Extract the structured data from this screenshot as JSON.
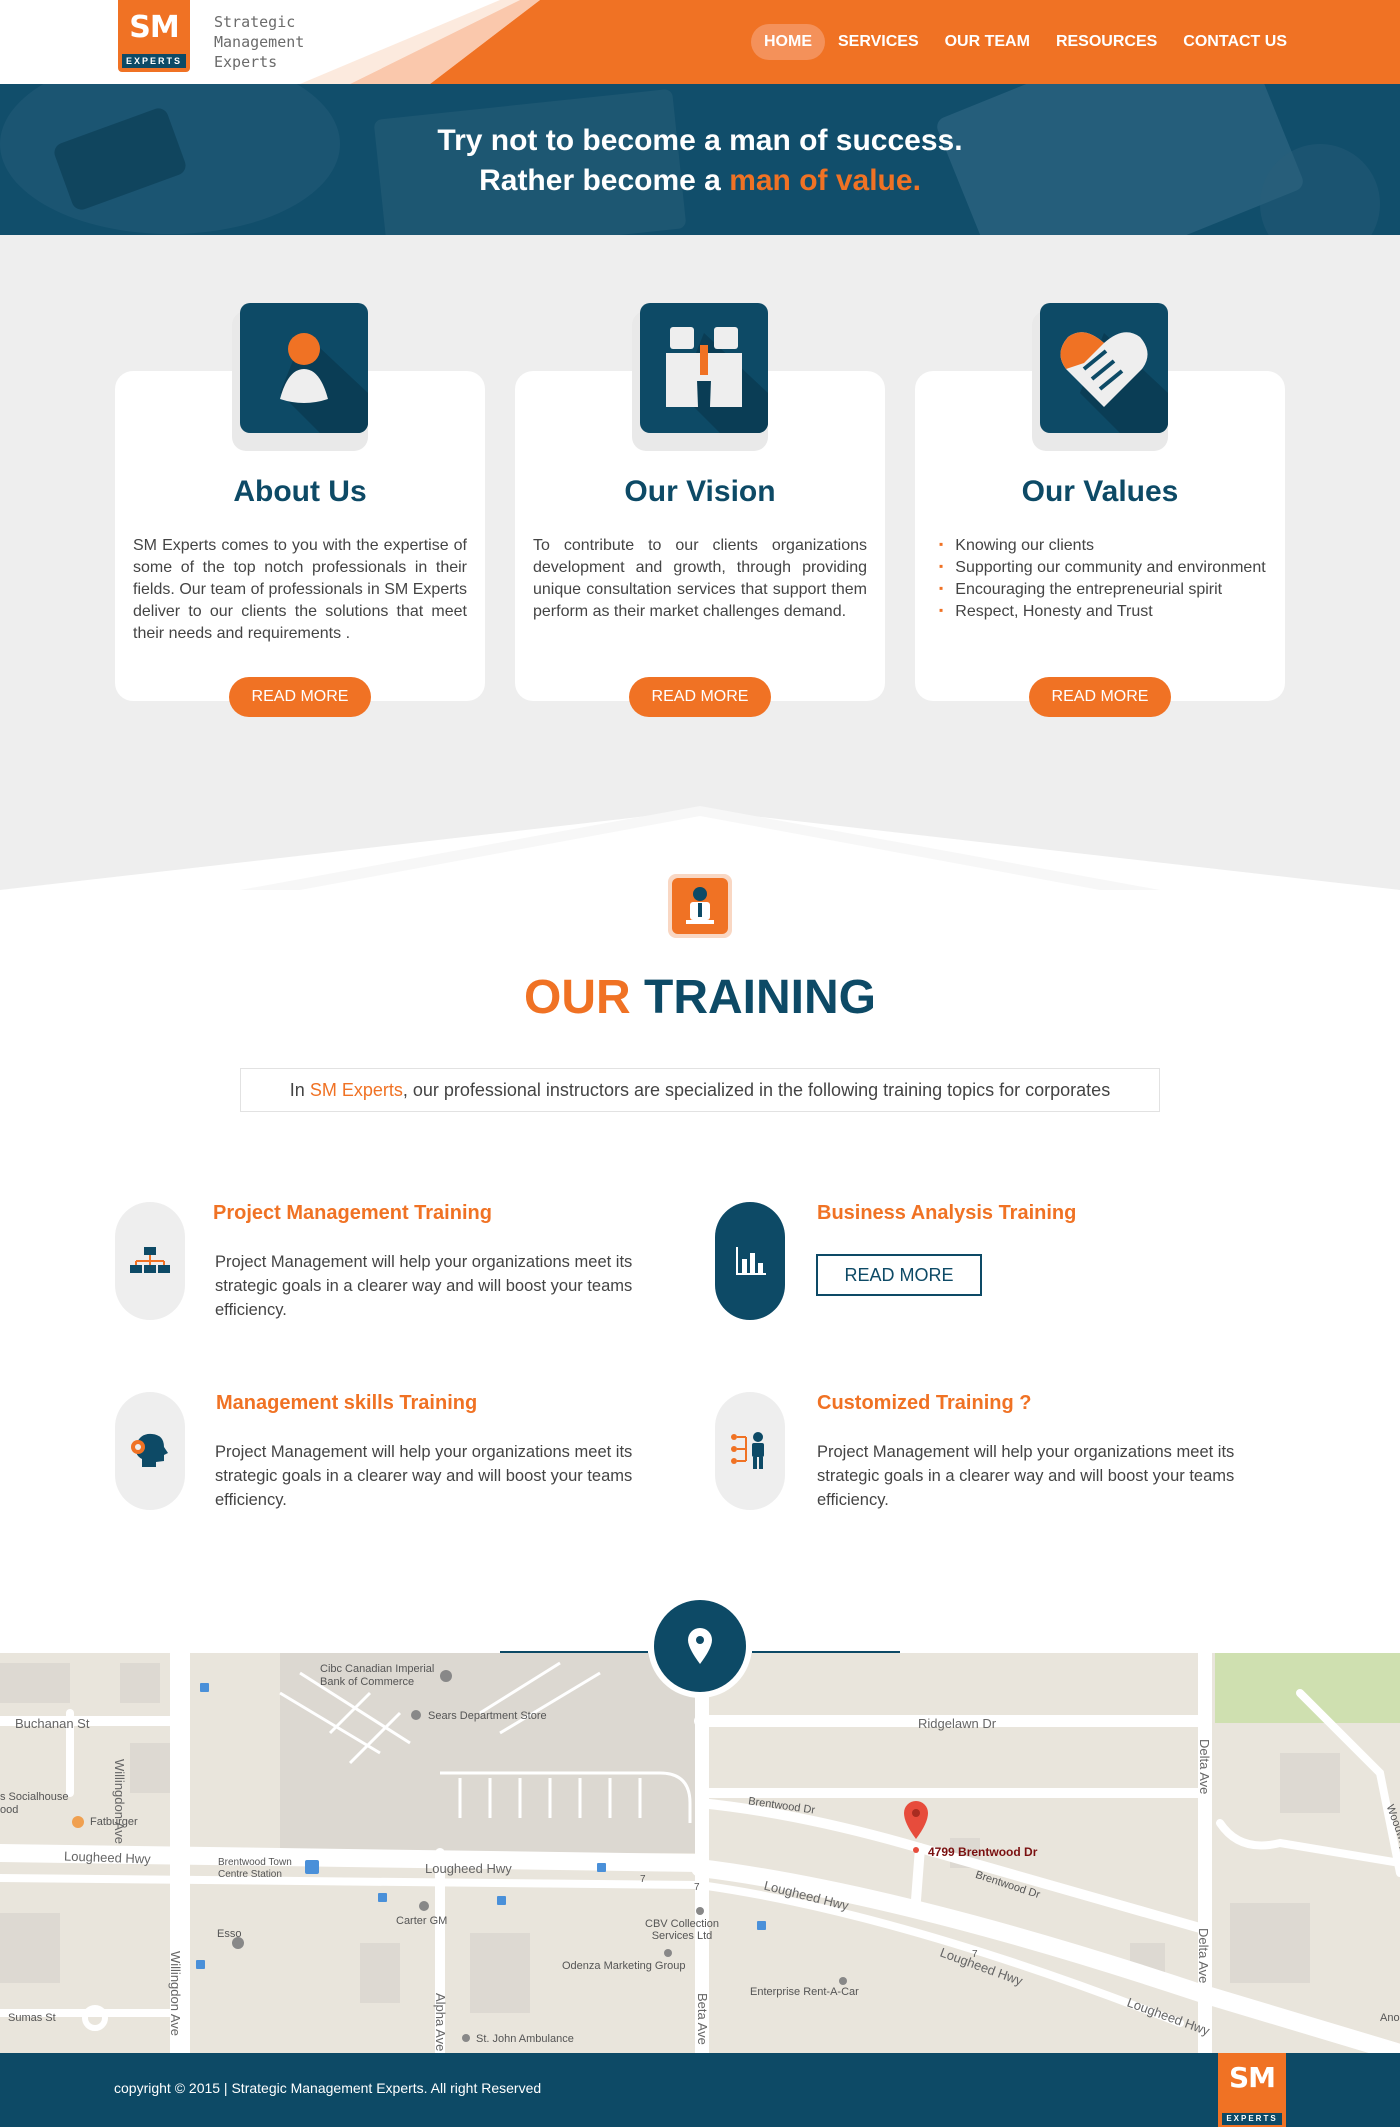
{
  "header": {
    "logo_mark": "SM",
    "logo_sub": "EXPERTS",
    "brand_lines": [
      "Strategic",
      "Management",
      "Experts"
    ],
    "nav": [
      "HOME",
      "SERVICES",
      "OUR TEAM",
      "RESOURCES",
      "CONTACT US"
    ],
    "active_nav": "HOME"
  },
  "hero": {
    "line1": "Try not to become a man of success.",
    "line2_prefix": "Rather become a ",
    "line2_accent": "man of value."
  },
  "features": [
    {
      "title": "About Us",
      "icon": "person-icon",
      "text": "SM Experts comes to you with the expertise of some of the top notch professionals in their fields. Our team of professionals in SM Experts deliver to our clients the solutions that meet their needs and requirements .",
      "button": "READ MORE"
    },
    {
      "title": "Our Vision",
      "icon": "binoculars-icon",
      "text": "To contribute to our clients organizations development and growth, through providing unique consultation services that support them perform as their market challenges demand.",
      "button": "READ MORE"
    },
    {
      "title": "Our Values",
      "icon": "handshake-icon",
      "list": [
        "Knowing our clients",
        "Supporting our community and environment",
        "Encouraging the entrepreneurial spirit",
        "Respect, Honesty and Trust"
      ],
      "button": "READ MORE"
    }
  ],
  "training": {
    "title_accent": "OUR",
    "title_rest": "TRAINING",
    "sub_prefix": "In ",
    "sub_accent": "SM Experts",
    "sub_rest": ", our professional instructors are specialized in the following training topics for corporates",
    "items": [
      {
        "title": "Project Management Training",
        "icon": "org-chart-icon",
        "desc": "Project Management will help your organizations meet its strategic goals in a clearer way and will boost your teams efficiency."
      },
      {
        "title": "Business Analysis Training",
        "icon": "bar-chart-icon",
        "button": "READ MORE"
      },
      {
        "title": "Management skills Training",
        "icon": "head-gear-icon",
        "desc": "Project Management will help your organizations meet its strategic goals in a clearer way and will boost your teams efficiency."
      },
      {
        "title": "Customized Training ?",
        "icon": "presenter-icon",
        "desc": "Project Management will help your organizations meet its strategic goals in a clearer way and will boost your teams efficiency."
      }
    ]
  },
  "map": {
    "address": "4799 Brentwood Dr",
    "labels": {
      "bank": "Cibc Canadian Imperial\nBank of Commerce",
      "sears": "Sears Department Store",
      "buchanan": "Buchanan St",
      "ridgelawn": "Ridgelawn Dr",
      "brentwood1": "Brentwood Dr",
      "brentwood2": "Brentwood Dr",
      "socialhouse": "s Socialhouse",
      "ood": "ood",
      "fatburger": "Fatburger",
      "lougheed1": "Lougheed Hwy",
      "lougheed2": "Lougheed Hwy",
      "lougheed3": "Lougheed Hwy",
      "lougheed4": "Lougheed Hwy",
      "lougheed5": "Lougheed Hwy",
      "brentwood_station": "Brentwood Town\nCentre Station",
      "carter": "Carter GM",
      "esso": "Esso",
      "cbv": "CBV Collection\nServices Ltd",
      "odenza": "Odenza Marketing Group",
      "enterprise": "Enterprise Rent-A-Car",
      "stjohn": "St. John Ambulance",
      "sumas": "Sumas St",
      "willingdon1": "Willingdon Ave",
      "willingdon2": "Willingdon Ave",
      "alpha": "Alpha Ave",
      "beta": "Beta Ave",
      "delta1": "Delta Ave",
      "delta2": "Delta Ave",
      "woodway": "Woodway Pl",
      "ano": "Ano",
      "hwy7a": "7",
      "hwy7b": "7",
      "hwy7c": "7"
    }
  },
  "footer": {
    "copyright": "copyright © 2015 | Strategic Management Experts. All right Reserved",
    "logo_mark": "SM",
    "logo_sub": "EXPERTS"
  },
  "colors": {
    "orange": "#f07224",
    "navy": "#0d4a66",
    "grey_bg": "#eeeeee"
  }
}
